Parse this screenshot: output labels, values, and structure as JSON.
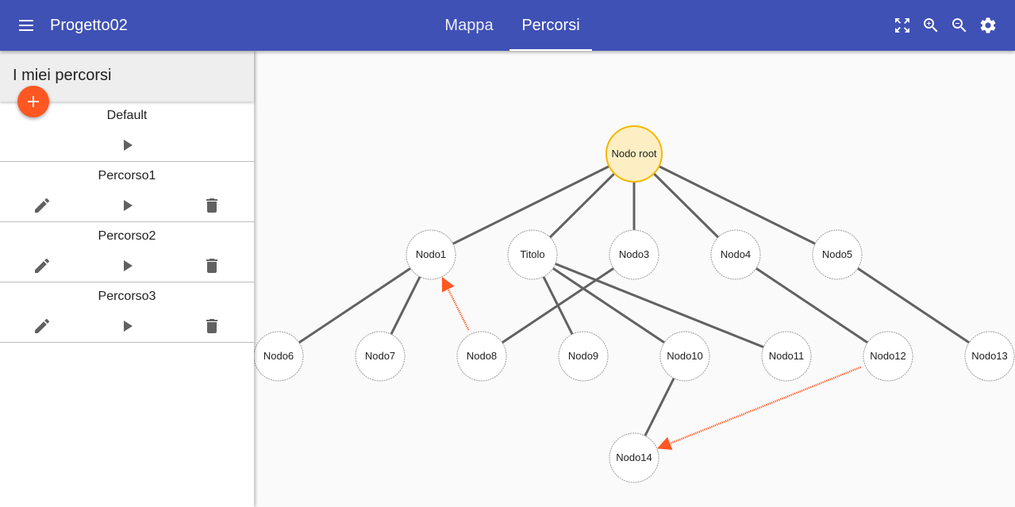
{
  "app": {
    "title": "Progetto02",
    "tabs": [
      {
        "label": "Mappa",
        "active": false
      },
      {
        "label": "Percorsi",
        "active": true
      }
    ],
    "primary_color": "#3f51b5",
    "accent_color": "#ff5722",
    "tools": [
      "fullscreen-icon",
      "zoom-in-icon",
      "zoom-out-icon",
      "settings-icon"
    ]
  },
  "sidebar": {
    "title": "I miei percorsi",
    "add_icon": "add-icon",
    "routes": [
      {
        "name": "Default",
        "editable": false
      },
      {
        "name": "Percorso1",
        "editable": true
      },
      {
        "name": "Percorso2",
        "editable": true
      },
      {
        "name": "Percorso3",
        "editable": true
      }
    ]
  },
  "graph": {
    "root_fill": "#fdefc3",
    "root_stroke": "#f5b700",
    "edge_color": "#616161",
    "link_color": "#ff5722",
    "nodes": [
      {
        "id": "root",
        "label": "Nodo root",
        "root": true
      },
      {
        "id": "n1",
        "label": "Nodo1"
      },
      {
        "id": "t",
        "label": "Titolo"
      },
      {
        "id": "n3",
        "label": "Nodo3"
      },
      {
        "id": "n4",
        "label": "Nodo4"
      },
      {
        "id": "n5",
        "label": "Nodo5"
      },
      {
        "id": "n6",
        "label": "Nodo6"
      },
      {
        "id": "n7",
        "label": "Nodo7"
      },
      {
        "id": "n8",
        "label": "Nodo8"
      },
      {
        "id": "n9",
        "label": "Nodo9"
      },
      {
        "id": "n10",
        "label": "Nodo10"
      },
      {
        "id": "n11",
        "label": "Nodo11"
      },
      {
        "id": "n12",
        "label": "Nodo12"
      },
      {
        "id": "n13",
        "label": "Nodo13"
      },
      {
        "id": "n14",
        "label": "Nodo14"
      }
    ],
    "edges": [
      [
        "root",
        "n1"
      ],
      [
        "root",
        "t"
      ],
      [
        "root",
        "n3"
      ],
      [
        "root",
        "n4"
      ],
      [
        "root",
        "n5"
      ],
      [
        "n1",
        "n6"
      ],
      [
        "n1",
        "n7"
      ],
      [
        "n3",
        "n8"
      ],
      [
        "t",
        "n9"
      ],
      [
        "t",
        "n10"
      ],
      [
        "t",
        "n11"
      ],
      [
        "n4",
        "n12"
      ],
      [
        "n5",
        "n13"
      ],
      [
        "n10",
        "n14"
      ]
    ],
    "links": [
      [
        "n8",
        "n1"
      ],
      [
        "n12",
        "n14"
      ]
    ]
  }
}
